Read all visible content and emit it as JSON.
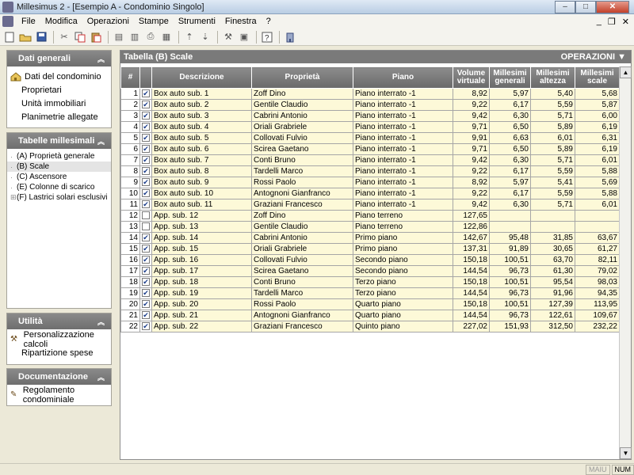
{
  "window": {
    "title": "Millesimus 2 - [Esempio A - Condominio Singolo]",
    "minimize": "–",
    "maximize": "□",
    "close": "✕"
  },
  "menu": {
    "items": [
      "File",
      "Modifica",
      "Operazioni",
      "Stampe",
      "Strumenti",
      "Finestra",
      "?"
    ],
    "mdi_minimize": "_",
    "mdi_restore": "❐",
    "mdi_close": "✕"
  },
  "sidebar": {
    "dati_generali": {
      "title": "Dati generali",
      "items": [
        "Dati del condominio",
        "Proprietari",
        "Unità immobiliari",
        "Planimetrie allegate"
      ]
    },
    "tabelle_millesimali": {
      "title": "Tabelle millesimali",
      "items": [
        "(A) Proprietà generale",
        "(B) Scale",
        "(C) Ascensore",
        "(E) Colonne di scarico",
        "(F) Lastrici solari esclusivi"
      ]
    },
    "utilita": {
      "title": "Utilità",
      "items": [
        "Personalizzazione calcoli",
        "Ripartizione spese"
      ]
    },
    "documentazione": {
      "title": "Documentazione",
      "items": [
        "Regolamento condominiale"
      ]
    }
  },
  "main": {
    "title": "Tabella (B) Scale",
    "operations_label": "OPERAZIONI",
    "columns": [
      "#",
      "",
      "Descrizione",
      "Proprietà",
      "Piano",
      "Volume virtuale",
      "Millesimi generali",
      "Millesimi altezza",
      "Millesimi scale"
    ],
    "rows": [
      {
        "n": "1",
        "checked": true,
        "desc": "Box auto sub. 1",
        "prop": "Zoff Dino",
        "piano": "Piano interrato -1",
        "vol": "8,92",
        "gen": "5,97",
        "alt": "5,40",
        "scale": "5,68"
      },
      {
        "n": "2",
        "checked": true,
        "desc": "Box auto sub. 2",
        "prop": "Gentile Claudio",
        "piano": "Piano interrato -1",
        "vol": "9,22",
        "gen": "6,17",
        "alt": "5,59",
        "scale": "5,87"
      },
      {
        "n": "3",
        "checked": true,
        "desc": "Box auto sub. 3",
        "prop": "Cabrini Antonio",
        "piano": "Piano interrato -1",
        "vol": "9,42",
        "gen": "6,30",
        "alt": "5,71",
        "scale": "6,00"
      },
      {
        "n": "4",
        "checked": true,
        "desc": "Box auto sub. 4",
        "prop": "Oriali Grabriele",
        "piano": "Piano interrato -1",
        "vol": "9,71",
        "gen": "6,50",
        "alt": "5,89",
        "scale": "6,19"
      },
      {
        "n": "5",
        "checked": true,
        "desc": "Box auto sub. 5",
        "prop": "Collovati Fulvio",
        "piano": "Piano interrato -1",
        "vol": "9,91",
        "gen": "6,63",
        "alt": "6,01",
        "scale": "6,31"
      },
      {
        "n": "6",
        "checked": true,
        "desc": "Box auto sub. 6",
        "prop": "Scirea Gaetano",
        "piano": "Piano interrato -1",
        "vol": "9,71",
        "gen": "6,50",
        "alt": "5,89",
        "scale": "6,19"
      },
      {
        "n": "7",
        "checked": true,
        "desc": "Box auto sub. 7",
        "prop": "Conti Bruno",
        "piano": "Piano interrato -1",
        "vol": "9,42",
        "gen": "6,30",
        "alt": "5,71",
        "scale": "6,01"
      },
      {
        "n": "8",
        "checked": true,
        "desc": "Box auto sub. 8",
        "prop": "Tardelli Marco",
        "piano": "Piano interrato -1",
        "vol": "9,22",
        "gen": "6,17",
        "alt": "5,59",
        "scale": "5,88"
      },
      {
        "n": "9",
        "checked": true,
        "desc": "Box auto sub. 9",
        "prop": "Rossi Paolo",
        "piano": "Piano interrato -1",
        "vol": "8,92",
        "gen": "5,97",
        "alt": "5,41",
        "scale": "5,69"
      },
      {
        "n": "10",
        "checked": true,
        "desc": "Box auto sub. 10",
        "prop": "Antognoni Gianfranco",
        "piano": "Piano interrato -1",
        "vol": "9,22",
        "gen": "6,17",
        "alt": "5,59",
        "scale": "5,88"
      },
      {
        "n": "11",
        "checked": true,
        "desc": "Box auto sub. 11",
        "prop": "Graziani Francesco",
        "piano": "Piano interrato -1",
        "vol": "9,42",
        "gen": "6,30",
        "alt": "5,71",
        "scale": "6,01"
      },
      {
        "n": "12",
        "checked": false,
        "desc": "App. sub. 12",
        "prop": "Zoff Dino",
        "piano": "Piano terreno",
        "vol": "127,65",
        "gen": "",
        "alt": "",
        "scale": ""
      },
      {
        "n": "13",
        "checked": false,
        "desc": "App. sub. 13",
        "prop": "Gentile Claudio",
        "piano": "Piano terreno",
        "vol": "122,86",
        "gen": "",
        "alt": "",
        "scale": ""
      },
      {
        "n": "14",
        "checked": true,
        "desc": "App. sub. 14",
        "prop": "Cabrini Antonio",
        "piano": "Primo piano",
        "vol": "142,67",
        "gen": "95,48",
        "alt": "31,85",
        "scale": "63,67"
      },
      {
        "n": "15",
        "checked": true,
        "desc": "App. sub. 15",
        "prop": "Oriali Grabriele",
        "piano": "Primo piano",
        "vol": "137,31",
        "gen": "91,89",
        "alt": "30,65",
        "scale": "61,27"
      },
      {
        "n": "16",
        "checked": true,
        "desc": "App. sub. 16",
        "prop": "Collovati Fulvio",
        "piano": "Secondo piano",
        "vol": "150,18",
        "gen": "100,51",
        "alt": "63,70",
        "scale": "82,11"
      },
      {
        "n": "17",
        "checked": true,
        "desc": "App. sub. 17",
        "prop": "Scirea Gaetano",
        "piano": "Secondo piano",
        "vol": "144,54",
        "gen": "96,73",
        "alt": "61,30",
        "scale": "79,02"
      },
      {
        "n": "18",
        "checked": true,
        "desc": "App. sub. 18",
        "prop": "Conti Bruno",
        "piano": "Terzo piano",
        "vol": "150,18",
        "gen": "100,51",
        "alt": "95,54",
        "scale": "98,03"
      },
      {
        "n": "19",
        "checked": true,
        "desc": "App. sub. 19",
        "prop": "Tardelli Marco",
        "piano": "Terzo piano",
        "vol": "144,54",
        "gen": "96,73",
        "alt": "91,96",
        "scale": "94,35"
      },
      {
        "n": "20",
        "checked": true,
        "desc": "App. sub. 20",
        "prop": "Rossi Paolo",
        "piano": "Quarto piano",
        "vol": "150,18",
        "gen": "100,51",
        "alt": "127,39",
        "scale": "113,95"
      },
      {
        "n": "21",
        "checked": true,
        "desc": "App. sub. 21",
        "prop": "Antognoni Gianfranco",
        "piano": "Quarto piano",
        "vol": "144,54",
        "gen": "96,73",
        "alt": "122,61",
        "scale": "109,67"
      },
      {
        "n": "22",
        "checked": true,
        "desc": "App. sub. 22",
        "prop": "Graziani Francesco",
        "piano": "Quinto piano",
        "vol": "227,02",
        "gen": "151,93",
        "alt": "312,50",
        "scale": "232,22"
      }
    ]
  },
  "statusbar": {
    "caps": "MAIU",
    "num": "NUM"
  },
  "colors": {
    "row_highlight": "#fdf9d8",
    "header_gray": "#7a7a7a"
  }
}
